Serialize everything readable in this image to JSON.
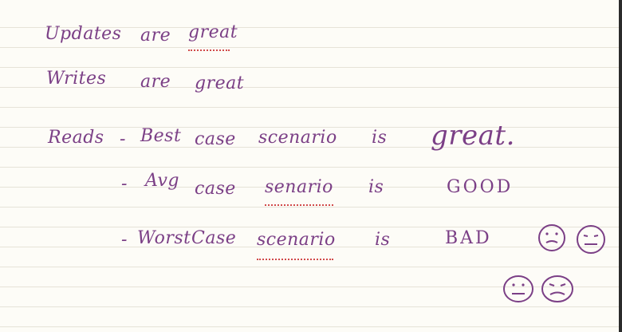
{
  "lines": [
    {
      "words": [
        "Updates",
        "are",
        "great"
      ]
    },
    {
      "words": [
        "Writes",
        "are",
        "great"
      ]
    },
    {
      "words": [
        "Reads",
        "-",
        "Best",
        "case",
        "scenario",
        "is",
        "great."
      ]
    },
    {
      "words": [
        "-",
        "Avg",
        "case",
        "senario",
        "is",
        "GOOD"
      ]
    },
    {
      "words": [
        "-",
        "Worst",
        "Case",
        "scenario",
        "is",
        "BAD"
      ]
    }
  ],
  "colors": {
    "ink": "#7b3f86",
    "underline": "#d14a4a",
    "rule": "#e6e3d8",
    "paper": "#fdfcf7"
  },
  "icons": [
    "sad-face-icon",
    "sad-face-icon",
    "sad-face-icon",
    "sad-face-icon"
  ]
}
